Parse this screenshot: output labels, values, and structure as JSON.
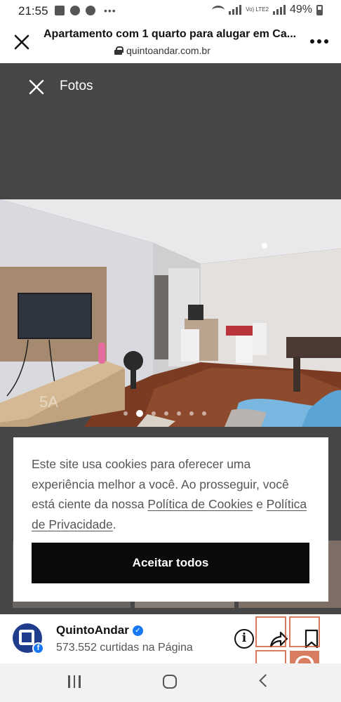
{
  "status_bar": {
    "time": "21:55",
    "battery": "49%",
    "network_label": "Vo) LTE2"
  },
  "browser": {
    "title": "Apartamento com 1 quarto para alugar em Ca...",
    "url": "quintoandar.com.br",
    "close_icon": "close-icon",
    "more_icon": "more-options-icon"
  },
  "gallery": {
    "title": "Fotos",
    "close_icon": "close-icon",
    "photo_count": 7,
    "active_photo_index": 1
  },
  "cookie_banner": {
    "text_intro": "Este site usa cookies para oferecer uma experiência melhor a você. Ao prosseguir, você está ciente da nossa ",
    "cookie_policy_link": "Política de Cookies",
    "text_and": " e ",
    "privacy_policy_link": "Política de Privacidade",
    "text_end": ".",
    "accept_label": "Aceitar todos"
  },
  "page_footer": {
    "page_name": "QuintoAndar",
    "likes": "573.552 curtidas na Página",
    "verified_icon": "verified-badge-icon",
    "info_icon": "info-icon",
    "share_icon": "share-icon",
    "save_icon": "bookmark-icon"
  },
  "colors": {
    "gallery_bg": "#464646",
    "button_bg": "#0a0a0a",
    "brand_blue": "#1f3d8c",
    "facebook_blue": "#1877f2",
    "watermark": "#c8471e"
  }
}
